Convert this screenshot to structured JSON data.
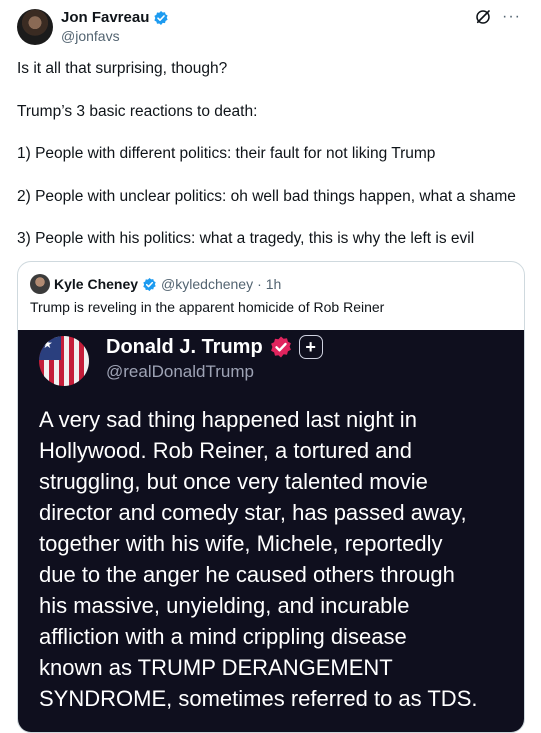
{
  "tweet": {
    "author_name": "Jon Favreau",
    "author_handle": "@jonfavs",
    "lines": [
      "Is it all that surprising, though?",
      "Trump’s 3 basic reactions to death:",
      "1) People with different politics: their fault for not liking Trump",
      "2) People with unclear politics: oh well bad things happen, what a shame",
      "3) People with his politics: what a tragedy, this is why the left is evil"
    ]
  },
  "quote": {
    "author_name": "Kyle Cheney",
    "author_handle": "@kyledcheney",
    "separator": "·",
    "time": "1h",
    "text": "Trump is reveling in the apparent homicide of Rob Reiner"
  },
  "truth_post": {
    "author_name": "Donald J. Trump",
    "author_handle": "@realDonaldTrump",
    "plus_badge": "+",
    "body_lines": [
      "A very sad thing happened last night in",
      "Hollywood. Rob Reiner, a tortured and",
      "struggling, but once very talented movie",
      "director and comedy star, has passed away,",
      "together with his wife, Michele, reportedly",
      "due to the anger he caused others through",
      "his massive, unyielding, and incurable",
      "affliction with a mind crippling disease",
      "known as TRUMP DERANGEMENT",
      "SYNDROME, sometimes referred to as TDS."
    ]
  },
  "icons": {
    "more": "···",
    "verified_color": "#1d9bf0",
    "truth_verified_color": "#e0245e"
  }
}
